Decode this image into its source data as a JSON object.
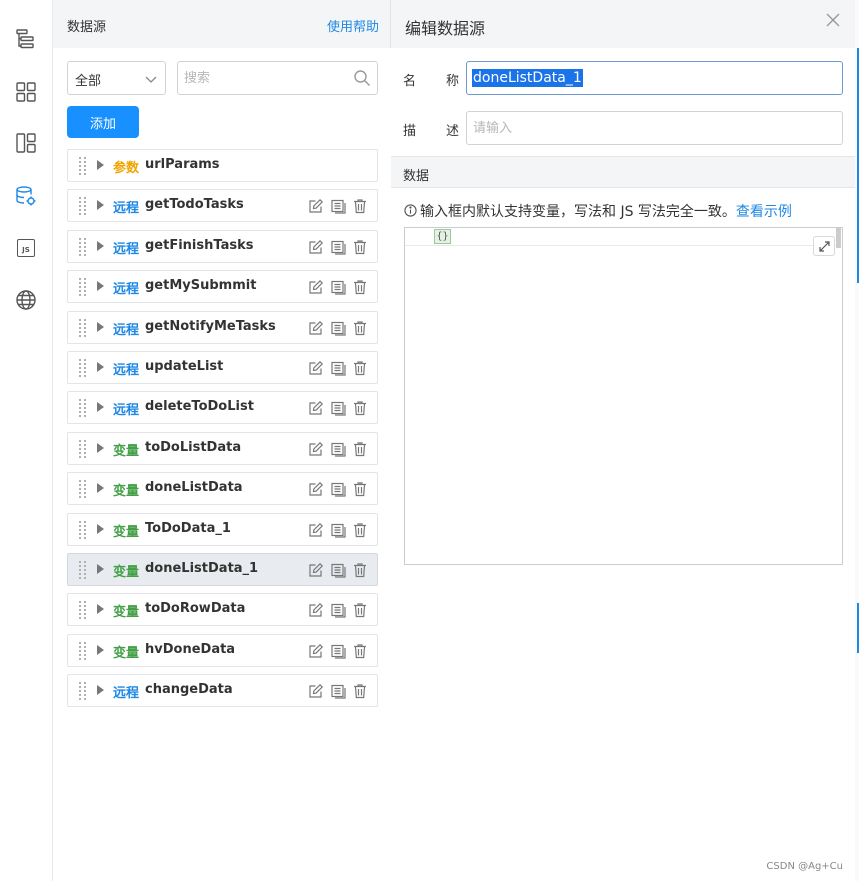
{
  "rail": {
    "items": [
      {
        "name": "outline-icon"
      },
      {
        "name": "components-icon"
      },
      {
        "name": "layout-icon"
      },
      {
        "name": "datasource-icon",
        "active": true
      },
      {
        "name": "js-icon",
        "text": "JS"
      },
      {
        "name": "globe-icon"
      }
    ]
  },
  "datasource_panel": {
    "title": "数据源",
    "help_link": "使用帮助",
    "filter": {
      "value": "全部"
    },
    "search": {
      "placeholder": "搜索"
    },
    "add_button": "添加",
    "items": [
      {
        "type": "param",
        "tag": "参数",
        "name": "urlParams",
        "actions": false
      },
      {
        "type": "remote",
        "tag": "远程",
        "name": "getTodoTasks",
        "actions": true
      },
      {
        "type": "remote",
        "tag": "远程",
        "name": "getFinishTasks",
        "actions": true
      },
      {
        "type": "remote",
        "tag": "远程",
        "name": "getMySubmmit",
        "actions": true
      },
      {
        "type": "remote",
        "tag": "远程",
        "name": "getNotifyMeTasks",
        "actions": true
      },
      {
        "type": "remote",
        "tag": "远程",
        "name": "updateList",
        "actions": true
      },
      {
        "type": "remote",
        "tag": "远程",
        "name": "deleteToDoList",
        "actions": true
      },
      {
        "type": "var",
        "tag": "变量",
        "name": "toDoListData",
        "actions": true
      },
      {
        "type": "var",
        "tag": "变量",
        "name": "doneListData",
        "actions": true
      },
      {
        "type": "var",
        "tag": "变量",
        "name": "ToDoData_1",
        "actions": true
      },
      {
        "type": "var",
        "tag": "变量",
        "name": "doneListData_1",
        "actions": true,
        "selected": true
      },
      {
        "type": "var",
        "tag": "变量",
        "name": "toDoRowData",
        "actions": true
      },
      {
        "type": "var",
        "tag": "变量",
        "name": "hvDoneData",
        "actions": true
      },
      {
        "type": "remote",
        "tag": "远程",
        "name": "changeData",
        "actions": true
      }
    ]
  },
  "edit_panel": {
    "title": "编辑数据源",
    "name_label": [
      "名",
      "称"
    ],
    "name_value": "doneListData_1",
    "desc_label": [
      "描",
      "述"
    ],
    "desc_placeholder": "请输入",
    "section_title": "数据",
    "tip": "输入框内默认支持变量，写法和 JS 写法完全一致。",
    "tip_link": "查看示例",
    "editor_content": "{}"
  },
  "watermark": "CSDN @Ag+Cu",
  "colors": {
    "accent": "#1890ff",
    "remote": "#1e88e5",
    "variable": "#43a047",
    "param": "#f0a500"
  }
}
